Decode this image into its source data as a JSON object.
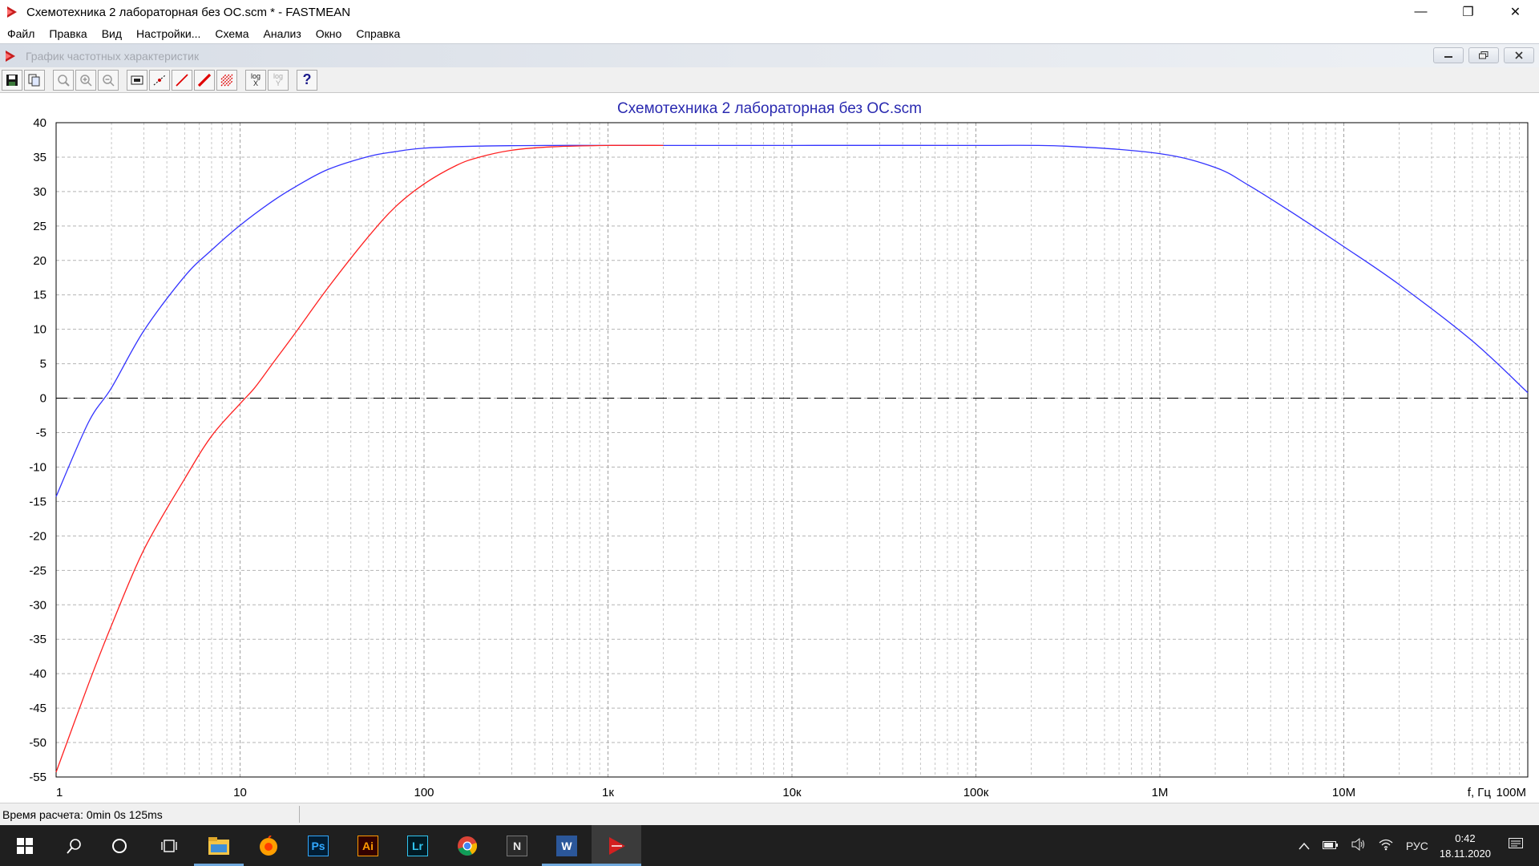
{
  "window": {
    "title": "Схемотехника 2 лабораторная без ОС.scm * - FASTMEAN",
    "minimize": "—",
    "maximize": "❐",
    "close": "✕"
  },
  "menu": [
    "Файл",
    "Правка",
    "Вид",
    "Настройки...",
    "Схема",
    "Анализ",
    "Окно",
    "Справка"
  ],
  "child_window": {
    "title": "График частотных характеристик"
  },
  "toolbar": {
    "buttons": [
      "save-icon",
      "copy-icon",
      "zoom-icon",
      "zoom-in-icon",
      "zoom-out-icon",
      "marker-icon",
      "cursor-icon",
      "line-red-icon",
      "line-bold-red-icon",
      "grid-icon",
      "log-x-icon",
      "log-y-icon",
      "help-icon"
    ],
    "log_label": "log",
    "x_label": "X",
    "y_label": "Y",
    "help_label": "?"
  },
  "chart_data": {
    "type": "line",
    "title": "Схемотехника 2 лабораторная без ОС.scm",
    "xlabel": "f, Гц",
    "x_scale": "log",
    "xlim": [
      1,
      100000000
    ],
    "ylim": [
      -55,
      40
    ],
    "x_tick_labels": [
      "1",
      "10",
      "100",
      "1к",
      "10к",
      "100к",
      "1М",
      "10М",
      "100М"
    ],
    "x_tick_values": [
      1,
      10,
      100,
      1000,
      10000,
      100000,
      1000000,
      10000000,
      100000000
    ],
    "y_ticks": [
      40,
      35,
      30,
      25,
      20,
      15,
      10,
      5,
      0,
      -5,
      -10,
      -15,
      -20,
      -25,
      -30,
      -35,
      -40,
      -45,
      -50,
      -55
    ],
    "grid": true,
    "reference_line": {
      "y": 0,
      "style": "dashed",
      "color": "#000000"
    },
    "series": [
      {
        "color": "#3333ff",
        "x": [
          1,
          1.5,
          2,
          3,
          5,
          7,
          10,
          15,
          20,
          30,
          50,
          70,
          100,
          200,
          500,
          1000,
          10000,
          100000,
          300000,
          1000000,
          2000000,
          3000000,
          5000000,
          10000000,
          20000000,
          50000000,
          100000000
        ],
        "y": [
          -14.3,
          -3.5,
          1.5,
          9.8,
          17.7,
          21.5,
          25.1,
          28.6,
          30.7,
          33.2,
          35.1,
          35.8,
          36.3,
          36.6,
          36.7,
          36.7,
          36.7,
          36.7,
          36.6,
          35.5,
          33.5,
          31.0,
          27.3,
          22.0,
          16.5,
          8.3,
          0.8
        ]
      },
      {
        "color": "#ff2020",
        "x": [
          1,
          1.5,
          2,
          3,
          5,
          7,
          10,
          12,
          15,
          20,
          30,
          50,
          70,
          100,
          150,
          200,
          300,
          500,
          1000,
          2000
        ],
        "y": [
          -54.3,
          -41.5,
          -33.0,
          -22.0,
          -11.7,
          -5.5,
          -0.8,
          1.5,
          5.0,
          9.5,
          16.0,
          23.5,
          27.8,
          31.1,
          33.8,
          35.0,
          36.0,
          36.5,
          36.7,
          36.7
        ]
      }
    ]
  },
  "status": {
    "calc_time": "Время расчета: 0min 0s 125ms"
  },
  "taskbar": {
    "apps": [
      "start-icon",
      "search-icon",
      "cortana-icon",
      "task-view-icon",
      "file-explorer-icon",
      "yandex-browser-icon",
      "photoshop-icon",
      "illustrator-icon",
      "lightroom-icon",
      "chrome-icon",
      "notion-icon",
      "word-icon",
      "fastmean-icon"
    ],
    "ps_label": "Ps",
    "ai_label": "Ai",
    "lr_label": "Lr",
    "n_label": "N",
    "w_label": "W",
    "lang": "РУС",
    "time": "0:42",
    "date": "18.11.2020"
  },
  "colors": {
    "title_blue": "#2a2ab0",
    "blue_series": "#3333ff",
    "red_series": "#ff2020",
    "grid": "#b8b8b8"
  }
}
